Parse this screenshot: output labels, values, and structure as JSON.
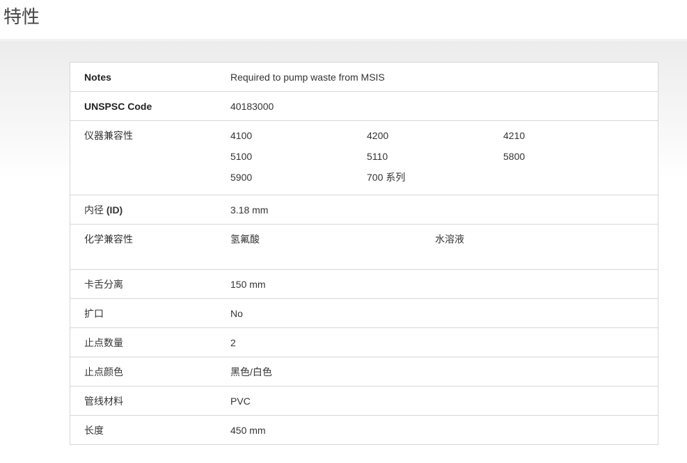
{
  "header": {
    "title": "特性"
  },
  "properties": {
    "notes": {
      "label": "Notes",
      "value": "Required to pump waste from MSIS"
    },
    "unspsc": {
      "label": "UNSPSC Code",
      "value": "40183000"
    },
    "instrument": {
      "label": "仪器兼容性",
      "values": [
        "4100",
        "4200",
        "4210",
        "5100",
        "5110",
        "5800",
        "5900",
        "700 系列"
      ]
    },
    "id": {
      "label_prefix": "内径 ",
      "label_bold": "(ID)",
      "value": "3.18 mm"
    },
    "chemical": {
      "label": "化学兼容性",
      "values": [
        "氢氟酸",
        "水溶液"
      ]
    },
    "tab_spacing": {
      "label": "卡舌分离",
      "value": "150 mm"
    },
    "flared": {
      "label": "扩口",
      "value": "No"
    },
    "stops_count": {
      "label": "止点数量",
      "value": "2"
    },
    "stop_color": {
      "label": "止点颜色",
      "value": "黑色/白色"
    },
    "tubing_material": {
      "label": "管线材料",
      "value": "PVC"
    },
    "length": {
      "label": "长度",
      "value": "450 mm"
    }
  }
}
